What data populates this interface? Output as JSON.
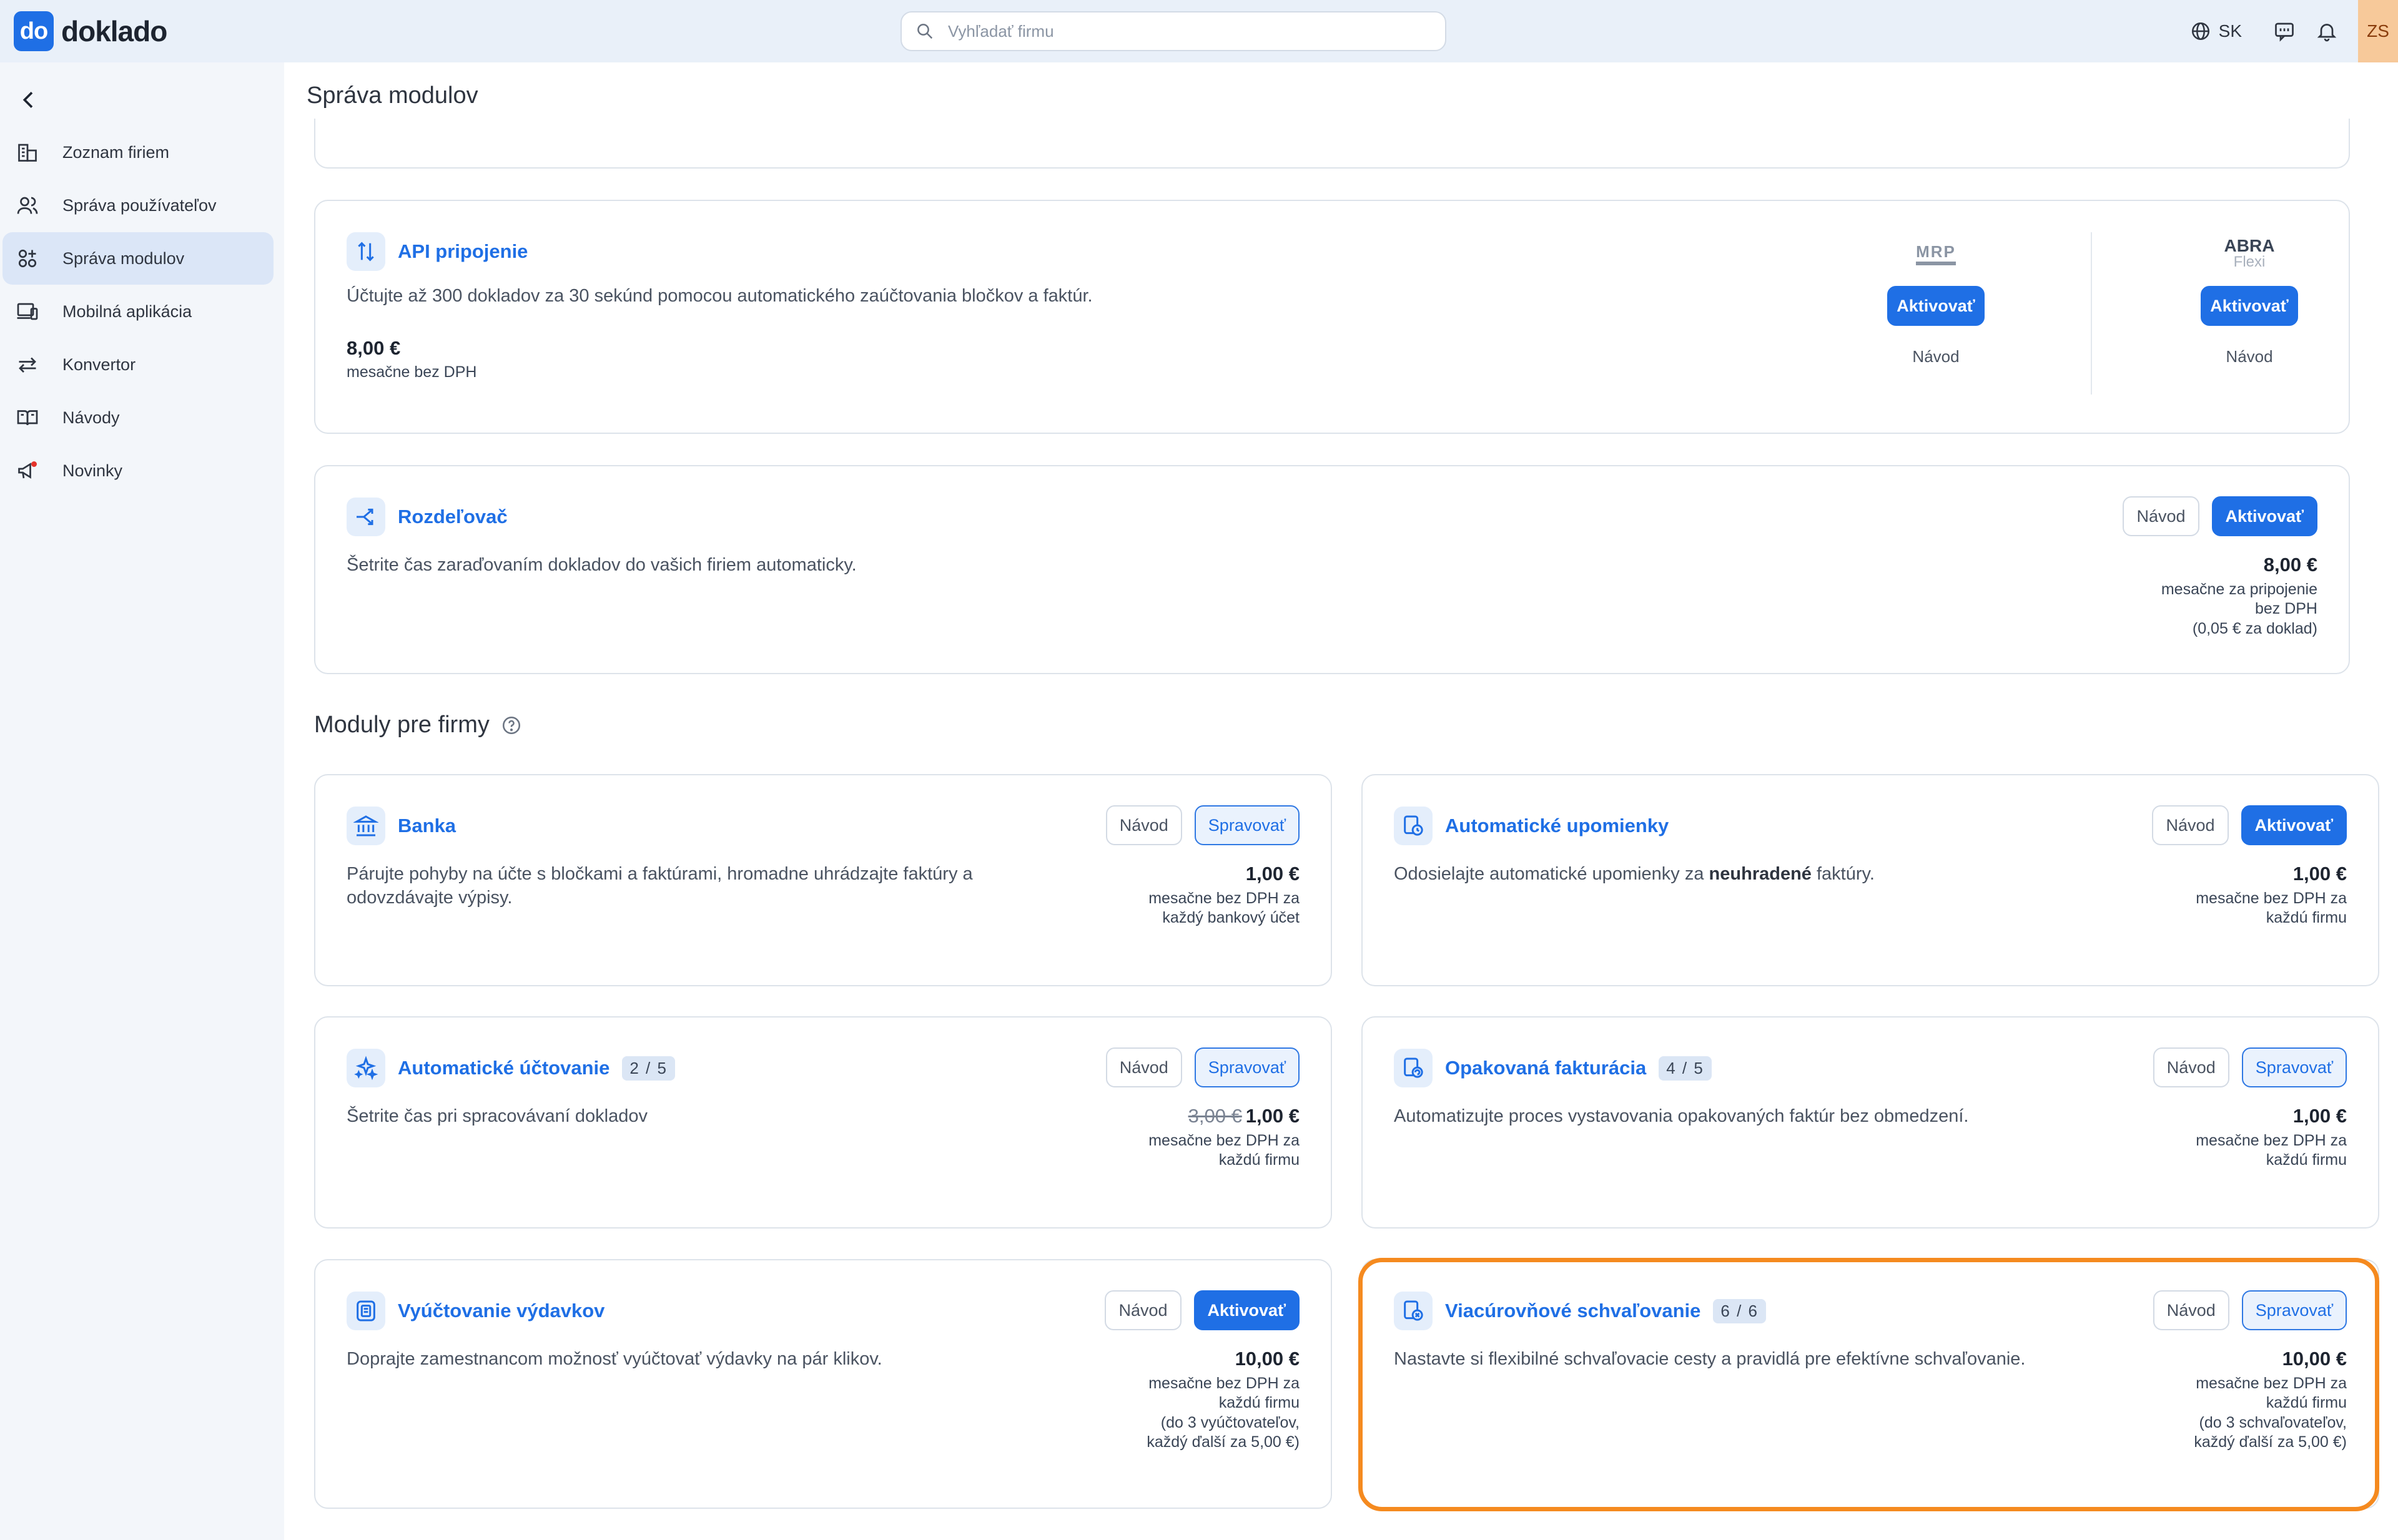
{
  "app": {
    "logo_mark": "do",
    "logo_text": "doklado"
  },
  "search": {
    "placeholder": "Vyhľadať firmu"
  },
  "topbar": {
    "lang": "SK",
    "avatar": "ZS"
  },
  "sidebar": {
    "items": [
      {
        "label": "Zoznam firiem",
        "icon": "buildings-icon"
      },
      {
        "label": "Správa používateľov",
        "icon": "users-icon"
      },
      {
        "label": "Správa modulov",
        "icon": "modules-icon",
        "active": true
      },
      {
        "label": "Mobilná aplikácia",
        "icon": "devices-icon"
      },
      {
        "label": "Konvertor",
        "icon": "convert-icon"
      },
      {
        "label": "Návody",
        "icon": "book-icon"
      },
      {
        "label": "Novinky",
        "icon": "megaphone-icon"
      }
    ]
  },
  "page": {
    "title": "Správa modulov"
  },
  "api": {
    "title": "API pripojenie",
    "desc": "Účtujte až 300 dokladov za 30 sekúnd pomocou automatického zaúčtovania bločkov a faktúr.",
    "amount": "8,00 €",
    "note": "mesačne bez DPH",
    "erp": [
      {
        "logo": "MRP",
        "button": "Aktivovať",
        "link": "Návod"
      },
      {
        "logo": "ABRA",
        "logo_sub": "Flexi",
        "button": "Aktivovať",
        "link": "Návod"
      }
    ]
  },
  "splitter": {
    "title": "Rozdeľovač",
    "desc": "Šetrite čas zaraďovaním dokladov do vašich firiem automaticky.",
    "guide": "Návod",
    "action": "Aktivovať",
    "amount": "8,00 €",
    "note1": "mesačne za pripojenie",
    "note2": "bez DPH",
    "note3": "(0,05 € za doklad)"
  },
  "section": {
    "title": "Moduly pre firmy"
  },
  "modules": {
    "bank": {
      "title": "Banka",
      "desc1": "Párujte pohyby na účte s bločkami a faktúrami, hromadne uhrádzajte faktúry a",
      "desc2": "odovzdávajte výpisy.",
      "guide": "Návod",
      "action": "Spravovať",
      "amount": "1,00 €",
      "note1": "mesačne bez DPH za",
      "note2": "každý bankový účet"
    },
    "reminders": {
      "title": "Automatické upomienky",
      "desc_pre": "Odosielajte automatické upomienky za ",
      "desc_bold": "neuhradené",
      "desc_post": " faktúry.",
      "guide": "Návod",
      "action": "Aktivovať",
      "amount": "1,00 €",
      "note1": "mesačne bez DPH za",
      "note2": "každú firmu"
    },
    "accounting": {
      "title": "Automatické účtovanie",
      "badge": "2 / 5",
      "desc": "Šetrite čas pri spracovávaní dokladov",
      "guide": "Návod",
      "action": "Spravovať",
      "old_amount": "3,00 €",
      "amount": "1,00 €",
      "note1": "mesačne bez DPH za",
      "note2": "každú firmu"
    },
    "recurring": {
      "title": "Opakovaná fakturácia",
      "badge": "4 / 5",
      "desc": "Automatizujte proces vystavovania opakovaných faktúr bez obmedzení.",
      "guide": "Návod",
      "action": "Spravovať",
      "amount": "1,00 €",
      "note1": "mesačne bez DPH za",
      "note2": "každú firmu"
    },
    "expenses": {
      "title": "Vyúčtovanie výdavkov",
      "desc": "Doprajte zamestnancom možnosť vyúčtovať výdavky na pár klikov.",
      "guide": "Návod",
      "action": "Aktivovať",
      "amount": "10,00 €",
      "note1": "mesačne bez DPH za",
      "note2": "každú firmu",
      "note3": "(do 3 vyúčtovateľov,",
      "note4": "každý ďalší za 5,00 €)"
    },
    "approval": {
      "title": "Viacúrovňové schvaľovanie",
      "badge": "6 / 6",
      "desc": "Nastavte si flexibilné schvaľovacie cesty a pravidlá pre efektívne schvaľovanie.",
      "guide": "Návod",
      "action": "Spravovať",
      "amount": "10,00 €",
      "note1": "mesačne bez DPH za",
      "note2": "každú firmu",
      "note3": "(do 3 schvaľovateľov,",
      "note4": "každý ďalší za 5,00 €)"
    }
  },
  "colors": {
    "accent": "#1f6fe5",
    "highlight": "#f58a1f",
    "avatar_bg": "#f7c99a"
  }
}
